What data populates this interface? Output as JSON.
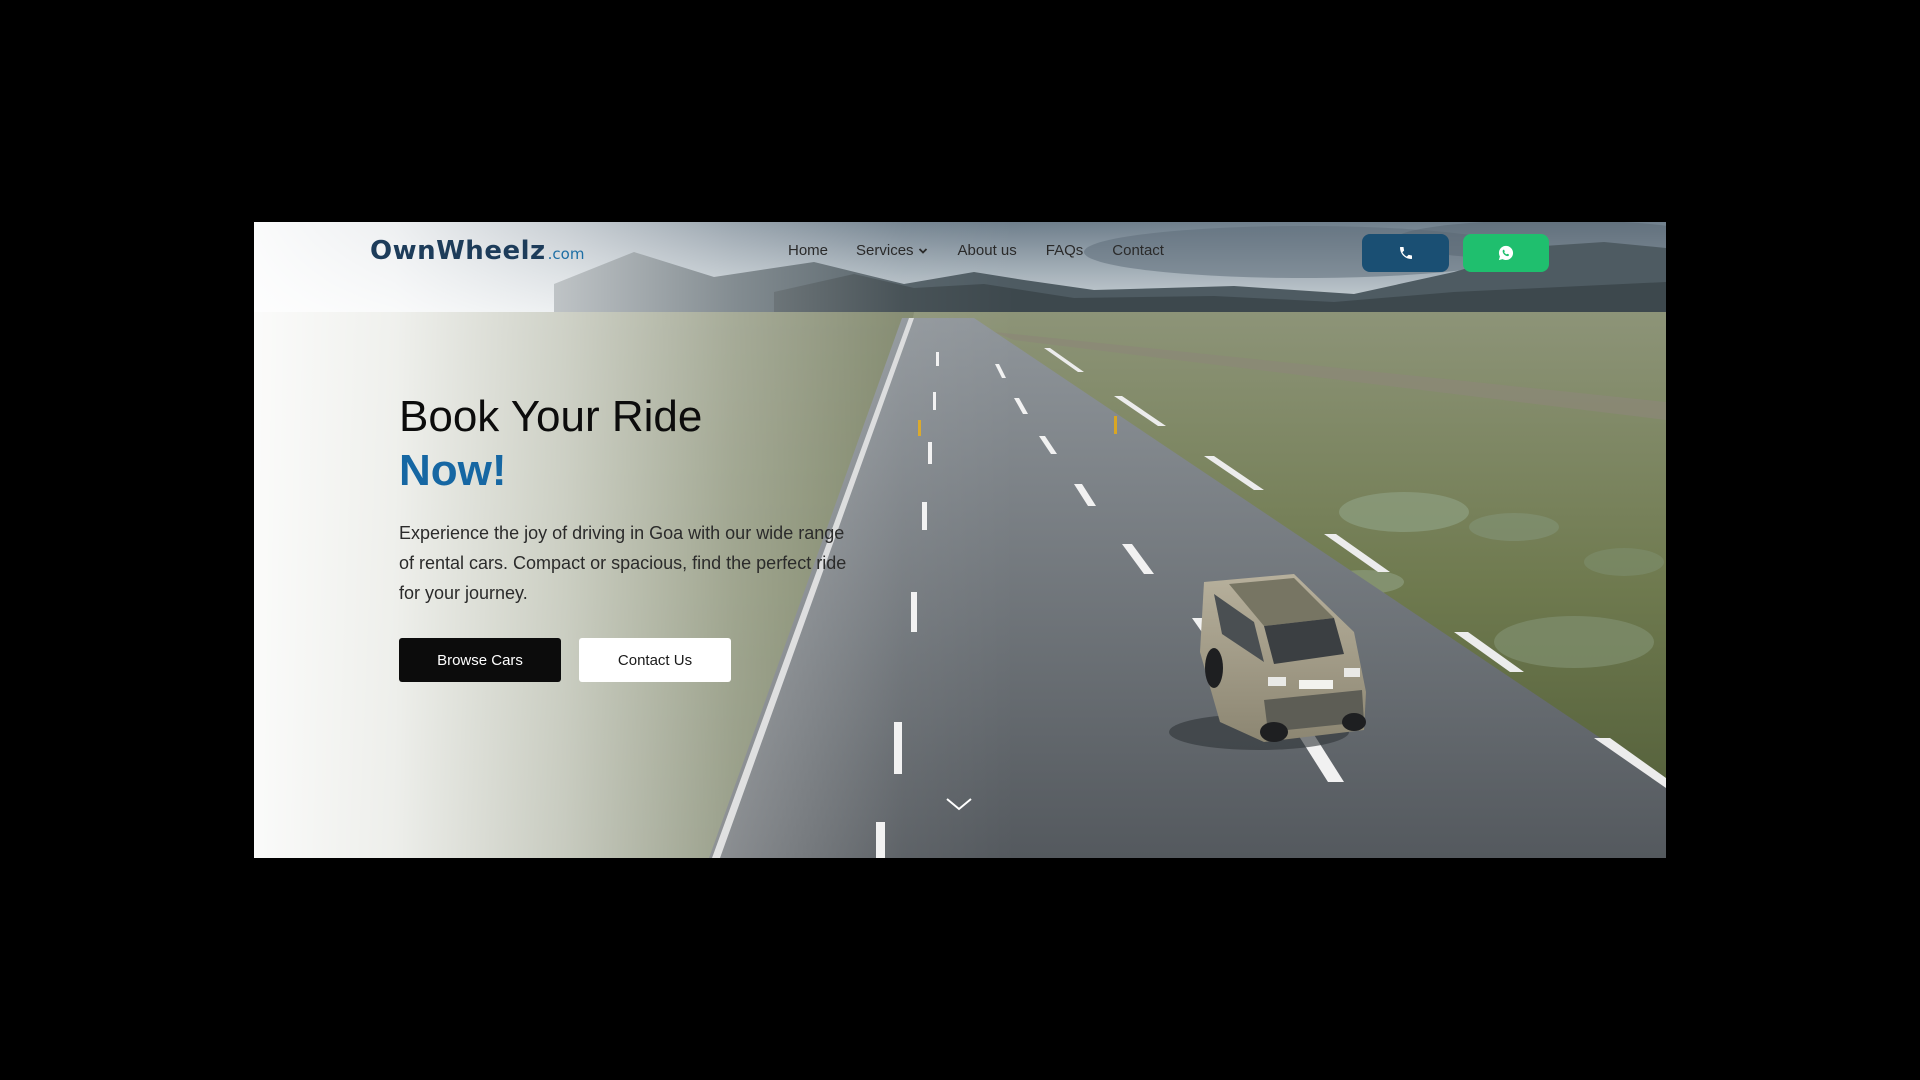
{
  "brand": {
    "logo_main": "OwnWheelz",
    "logo_suffix": ".com"
  },
  "nav": {
    "items": [
      {
        "label": "Home"
      },
      {
        "label": "Services",
        "has_dropdown": true
      },
      {
        "label": "About us"
      },
      {
        "label": "FAQs"
      },
      {
        "label": "Contact"
      }
    ]
  },
  "header_actions": {
    "phone_icon": "phone-icon",
    "whatsapp_icon": "whatsapp-icon",
    "phone_color": "#1a4f73",
    "whatsapp_color": "#1fbf6e"
  },
  "hero": {
    "title_line1": "Book Your Ride",
    "title_line2": "Now!",
    "description": "Experience the joy of driving in Goa with our wide range of rental cars. Compact or spacious, find the perfect ride for your journey.",
    "primary_button": "Browse Cars",
    "secondary_button": "Contact Us",
    "accent_color": "#1667a3",
    "scroll_icon": "chevron-down-icon"
  }
}
